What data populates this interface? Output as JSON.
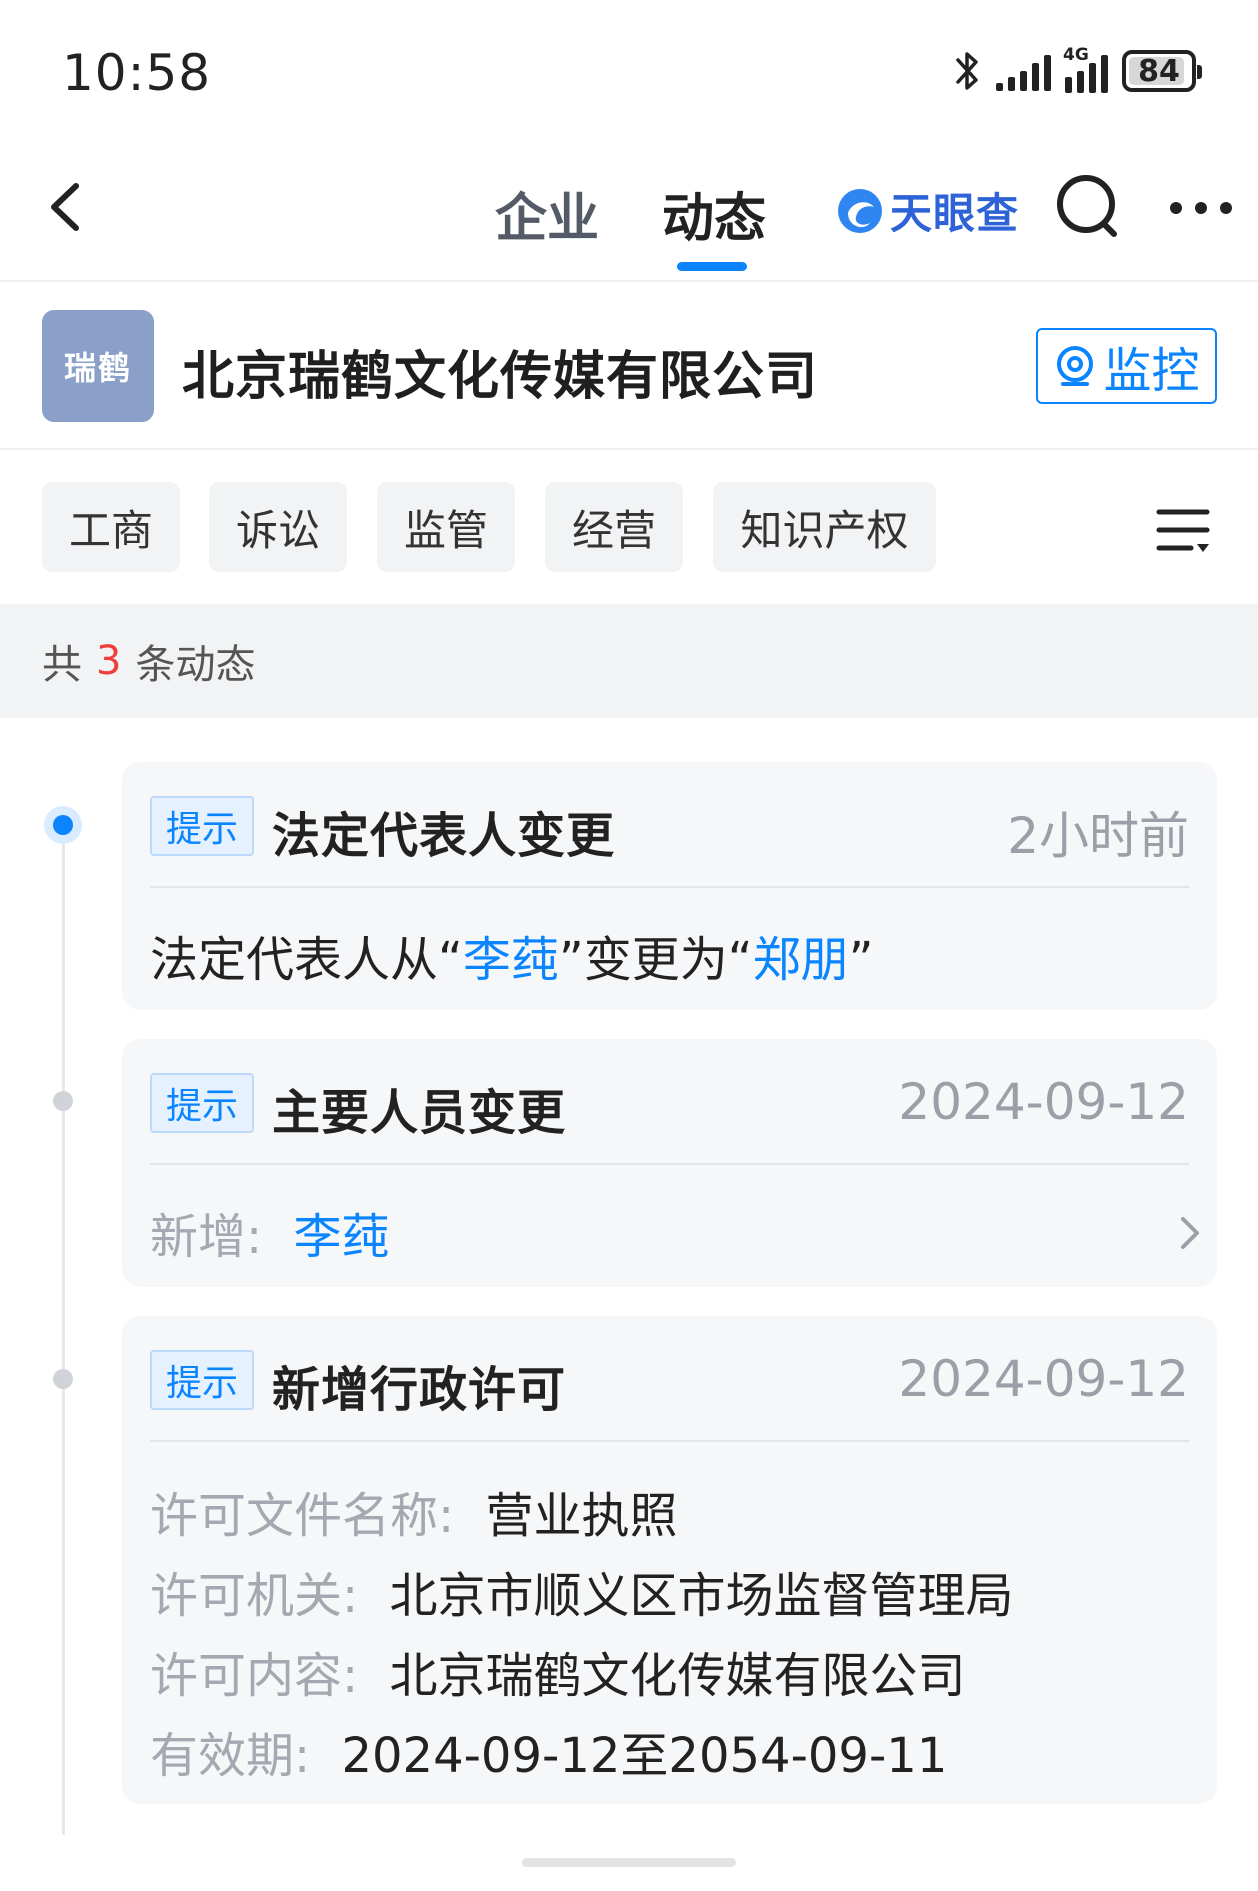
{
  "status_bar": {
    "time": "10:58",
    "network_label": "4G",
    "battery": "84"
  },
  "nav": {
    "tab_company": "企业",
    "tab_dynamic": "动态",
    "brand_name": "天眼查",
    "accent_color": "#0a84ff"
  },
  "company": {
    "logo_text": "瑞鹤",
    "name": "北京瑞鹤文化传媒有限公司",
    "monitor_label": "监控"
  },
  "filters": [
    "工商",
    "诉讼",
    "监管",
    "经营",
    "知识产权"
  ],
  "count": {
    "prefix": "共",
    "number": "3",
    "suffix": "条动态"
  },
  "events": [
    {
      "badge": "提示",
      "title": "法定代表人变更",
      "time": "2小时前",
      "body": {
        "part1": "法定代表人从“",
        "old_name": "李莼",
        "part2": "”变更为“",
        "new_name": "郑朋",
        "part3": "”"
      }
    },
    {
      "badge": "提示",
      "title": "主要人员变更",
      "time": "2024-09-12",
      "body": {
        "label": "新增:",
        "value": "李莼"
      }
    },
    {
      "badge": "提示",
      "title": "新增行政许可",
      "time": "2024-09-12",
      "fields": [
        {
          "label": "许可文件名称:",
          "value": "营业执照"
        },
        {
          "label": "许可机关:",
          "value": "北京市顺义区市场监督管理局"
        },
        {
          "label": "许可内容:",
          "value": "北京瑞鹤文化传媒有限公司"
        },
        {
          "label": "有效期:",
          "value": "2024-09-12至2054-09-11"
        }
      ]
    }
  ]
}
